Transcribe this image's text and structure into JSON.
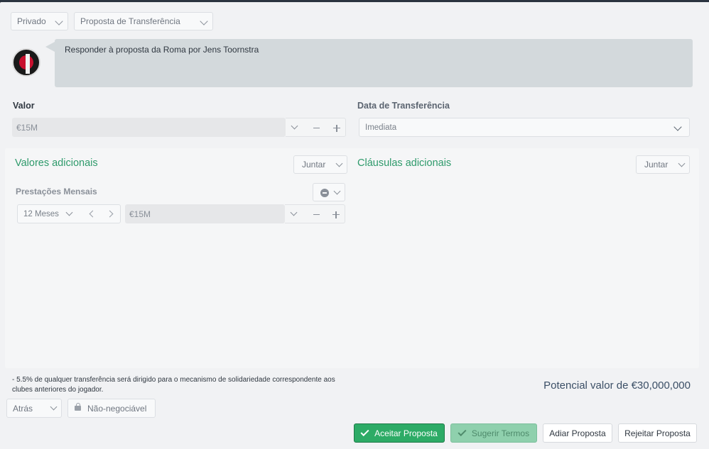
{
  "header": {
    "visibility": "Privado",
    "proposal_type": "Proposta de Transferência"
  },
  "message": {
    "text": "Responder à proposta da Roma por Jens Toornstra"
  },
  "valor": {
    "label": "Valor",
    "value": "€15M"
  },
  "transfer_date": {
    "label": "Data de Transferência",
    "value": "Imediata"
  },
  "additional_values": {
    "title": "Valores adicionais",
    "add_label": "Juntar",
    "installments": {
      "label": "Prestações Mensais",
      "period": "12 Meses",
      "amount": "€15M"
    }
  },
  "additional_clauses": {
    "title": "Cláusulas adicionais",
    "add_label": "Juntar"
  },
  "footer": {
    "solidarity_note": "- 5.5% de qualquer transferência será dirigido para o mecanismo de solidariedade correspondente aos clubes anteriores do jogador.",
    "potential_value": "Potencial valor de €30,000,000",
    "back_label": "Atrás",
    "non_negotiable_label": "Não-negociável"
  },
  "actions": {
    "accept": "Aceitar Proposta",
    "suggest": "Sugerir Termos",
    "postpone": "Adiar Proposta",
    "reject": "Rejeitar Proposta"
  },
  "colors": {
    "accent_green": "#2dab66",
    "heading_green": "#2e9a6b",
    "panel_bg": "#f1f2f4"
  }
}
